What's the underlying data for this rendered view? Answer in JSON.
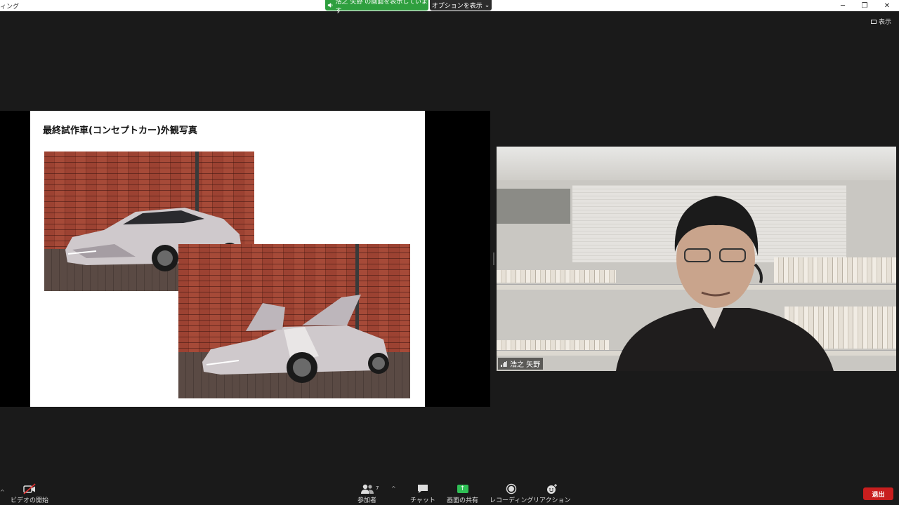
{
  "titlebar": {
    "app_title": "ィング",
    "share_status": "浩之 矢野 の画面を表示しています",
    "view_options_label": "オプションを表示",
    "view_options_caret": "⌄",
    "minimize_glyph": "─",
    "restore_glyph": "❐",
    "close_glyph": "✕"
  },
  "view_toggle": {
    "label": "表示"
  },
  "slide": {
    "title": "最終試作車(コンセプトカー)外観写真"
  },
  "participant": {
    "name": "浩之 矢野"
  },
  "toolbar": {
    "video_label": "ビデオの開始",
    "participants_label": "参加者",
    "participants_count": "7",
    "caret": "^",
    "chat_label": "チャット",
    "share_label": "画面の共有",
    "record_label": "レコーディング",
    "reaction_label": "リアクション",
    "leave_label": "退出",
    "left_edge_glyph": "^"
  },
  "colors": {
    "share_green": "#2e9f3e",
    "leave_red": "#c81e1e",
    "share_button_green": "#2fbf55",
    "background": "#1a1a1a"
  }
}
